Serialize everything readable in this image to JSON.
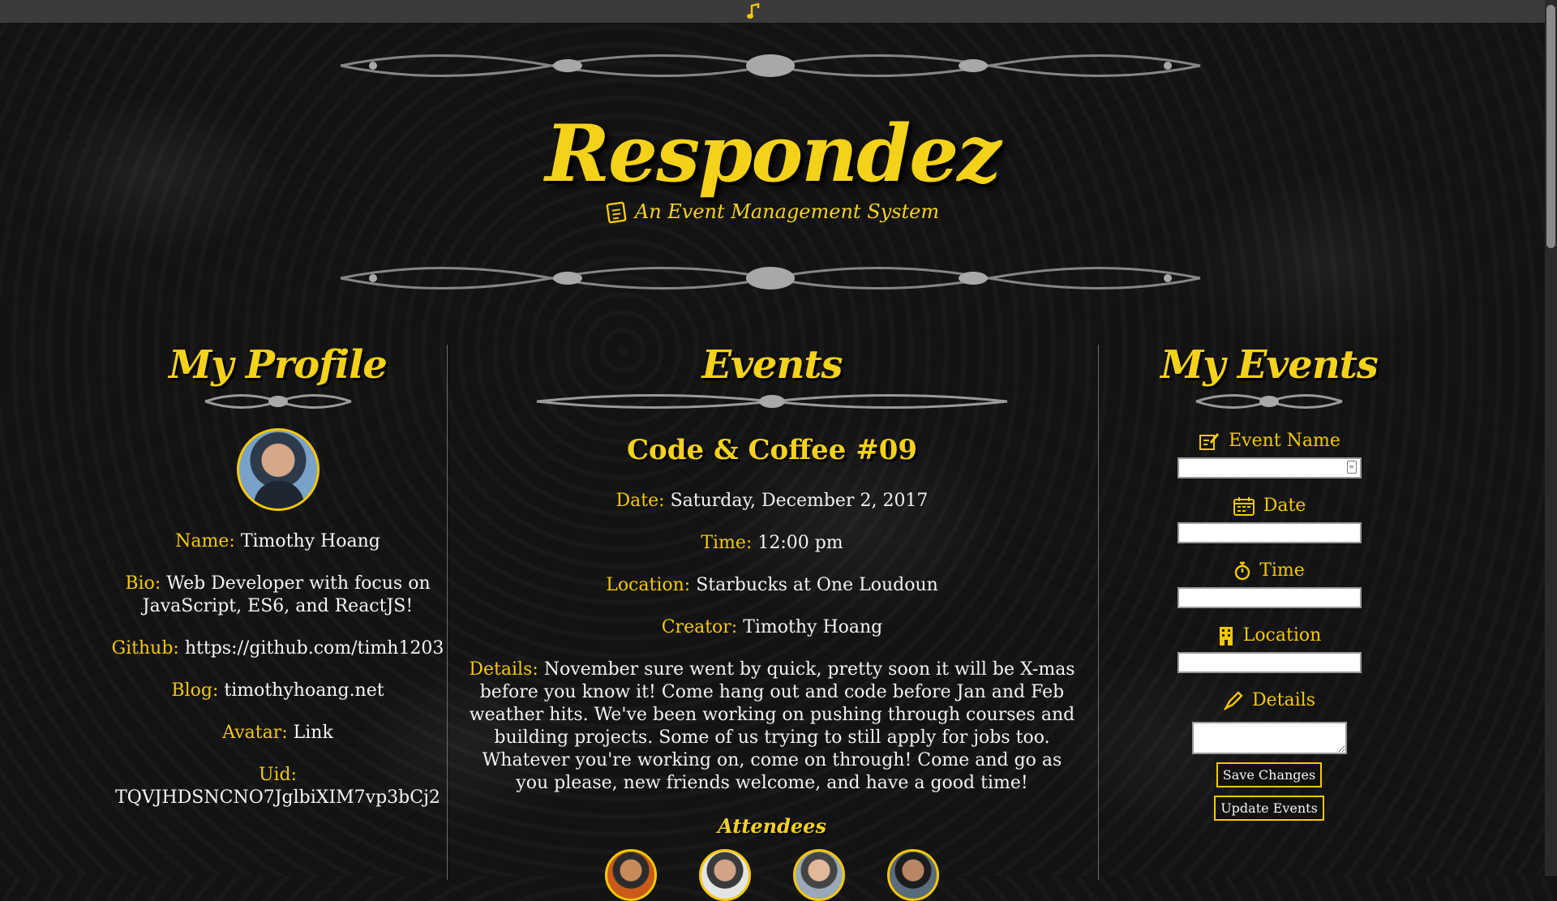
{
  "nav": {
    "home_icon": "music-note-icon"
  },
  "hero": {
    "title": "Respondez",
    "subtitle": "An Event Management System",
    "subtitle_icon": "notepad-icon"
  },
  "profile": {
    "heading": "My Profile",
    "fields": {
      "name": {
        "label": "Name:",
        "value": "Timothy Hoang"
      },
      "bio": {
        "label": "Bio:",
        "value": "Web Developer with focus on JavaScript, ES6, and ReactJS!"
      },
      "github": {
        "label": "Github:",
        "value": "https://github.com/timh1203"
      },
      "blog": {
        "label": "Blog:",
        "value": "timothyhoang.net"
      },
      "avatar": {
        "label": "Avatar:",
        "value": "Link"
      },
      "uid": {
        "label": "Uid:",
        "value": "TQVJHDSNCNO7JglbiXIM7vp3bCj2"
      }
    }
  },
  "events": {
    "heading": "Events",
    "event": {
      "title": "Code & Coffee #09",
      "date": {
        "label": "Date:",
        "value": "Saturday, December 2, 2017"
      },
      "time": {
        "label": "Time:",
        "value": "12:00 pm"
      },
      "location": {
        "label": "Location:",
        "value": "Starbucks at One Loudoun"
      },
      "creator": {
        "label": "Creator:",
        "value": "Timothy Hoang"
      },
      "details": {
        "label": "Details:",
        "value": "November sure went by quick, pretty soon it will be X-mas before you know it! Come hang out and code before Jan and Feb weather hits. We've been working on pushing through courses and building projects. Some of us trying to still apply for jobs too. Whatever you're working on, come on through! Come and go as you please, new friends welcome, and have a good time!"
      },
      "attendees_heading": "Attendees"
    }
  },
  "my_events": {
    "heading": "My Events",
    "form": {
      "event_name": {
        "label": "Event Name",
        "icon": "edit-note-icon",
        "value": ""
      },
      "date": {
        "label": "Date",
        "icon": "calendar-icon",
        "value": ""
      },
      "time": {
        "label": "Time",
        "icon": "stopwatch-icon",
        "value": ""
      },
      "location": {
        "label": "Location",
        "icon": "building-icon",
        "value": ""
      },
      "details": {
        "label": "Details",
        "icon": "pen-icon",
        "value": ""
      }
    },
    "save_button": "Save Changes",
    "update_button": "Update Events"
  },
  "colors": {
    "accent": "#f5c800",
    "background": "#131313",
    "topbar": "#3b3b3b"
  }
}
